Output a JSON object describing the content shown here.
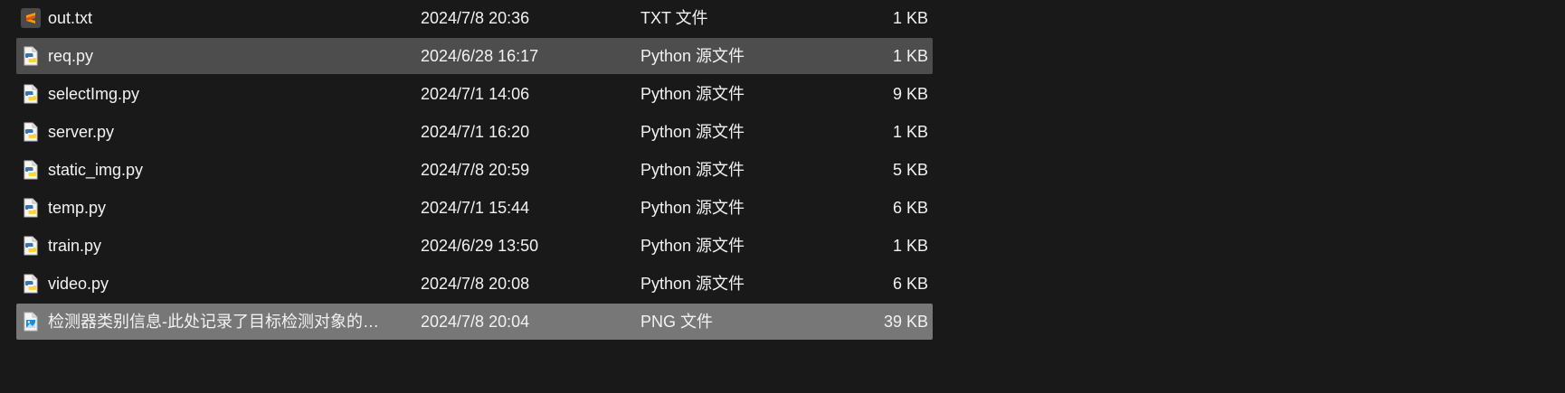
{
  "files": [
    {
      "name": "out.txt",
      "date": "2024/7/8 20:36",
      "type": "TXT 文件",
      "size": "1 KB",
      "icon": "sublime-text-icon",
      "state": "normal"
    },
    {
      "name": "req.py",
      "date": "2024/6/28 16:17",
      "type": "Python 源文件",
      "size": "1 KB",
      "icon": "python-file-icon",
      "state": "selected"
    },
    {
      "name": "selectImg.py",
      "date": "2024/7/1 14:06",
      "type": "Python 源文件",
      "size": "9 KB",
      "icon": "python-file-icon",
      "state": "normal"
    },
    {
      "name": "server.py",
      "date": "2024/7/1 16:20",
      "type": "Python 源文件",
      "size": "1 KB",
      "icon": "python-file-icon",
      "state": "normal"
    },
    {
      "name": "static_img.py",
      "date": "2024/7/8 20:59",
      "type": "Python 源文件",
      "size": "5 KB",
      "icon": "python-file-icon",
      "state": "normal"
    },
    {
      "name": "temp.py",
      "date": "2024/7/1 15:44",
      "type": "Python 源文件",
      "size": "6 KB",
      "icon": "python-file-icon",
      "state": "normal"
    },
    {
      "name": "train.py",
      "date": "2024/6/29 13:50",
      "type": "Python 源文件",
      "size": "1 KB",
      "icon": "python-file-icon",
      "state": "normal"
    },
    {
      "name": "video.py",
      "date": "2024/7/8 20:08",
      "type": "Python 源文件",
      "size": "6 KB",
      "icon": "python-file-icon",
      "state": "normal"
    },
    {
      "name": "检测器类别信息-此处记录了目标检测对象的类...",
      "date": "2024/7/8 20:04",
      "type": "PNG 文件",
      "size": "39 KB",
      "icon": "png-image-icon",
      "state": "highlighted"
    }
  ],
  "colors": {
    "background": "#191919",
    "selected_row": "#4d4d4d",
    "highlighted_row": "#777777",
    "text": "#f2f2f2"
  }
}
